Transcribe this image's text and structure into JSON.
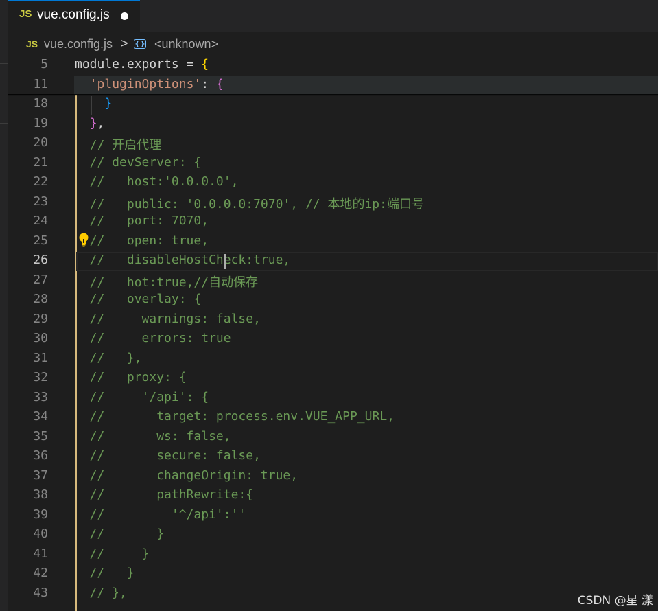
{
  "tab": {
    "badge": "JS",
    "filename": "vue.config.js"
  },
  "breadcrumb": {
    "badge": "JS",
    "file": "vue.config.js",
    "separator": ">",
    "symbol": "<unknown>"
  },
  "lines": [
    {
      "n": "5",
      "segs": [
        {
          "t": "module.exports = ",
          "c": "white"
        },
        {
          "t": "{",
          "c": "yellow"
        }
      ]
    },
    {
      "n": "11",
      "segs": [
        {
          "t": "  ",
          "c": "white"
        },
        {
          "t": "'pluginOptions'",
          "c": "str"
        },
        {
          "t": ": ",
          "c": "white"
        },
        {
          "t": "{",
          "c": "pink"
        }
      ]
    },
    {
      "n": "18",
      "segs": [
        {
          "t": "    ",
          "c": "white"
        },
        {
          "t": "}",
          "c": "blue"
        }
      ]
    },
    {
      "n": "19",
      "segs": [
        {
          "t": "  ",
          "c": "white"
        },
        {
          "t": "}",
          "c": "pink"
        },
        {
          "t": ",",
          "c": "white"
        }
      ]
    },
    {
      "n": "20",
      "segs": [
        {
          "t": "  // 开启代理",
          "c": "comment"
        }
      ]
    },
    {
      "n": "21",
      "segs": [
        {
          "t": "  // devServer: {",
          "c": "comment"
        }
      ]
    },
    {
      "n": "22",
      "segs": [
        {
          "t": "  //   host:'0.0.0.0',",
          "c": "comment"
        }
      ]
    },
    {
      "n": "23",
      "segs": [
        {
          "t": "  //   public: '0.0.0.0:7070', // 本地的ip:端口号",
          "c": "comment"
        }
      ]
    },
    {
      "n": "24",
      "segs": [
        {
          "t": "  //   port: 7070,",
          "c": "comment"
        }
      ]
    },
    {
      "n": "25",
      "segs": [
        {
          "t": "  //   open: true,",
          "c": "comment"
        }
      ]
    },
    {
      "n": "26",
      "segs": [
        {
          "t": "  //   disableHostCheck:true,",
          "c": "comment"
        }
      ]
    },
    {
      "n": "27",
      "segs": [
        {
          "t": "  //   hot:true,//自动保存",
          "c": "comment"
        }
      ]
    },
    {
      "n": "28",
      "segs": [
        {
          "t": "  //   overlay: {",
          "c": "comment"
        }
      ]
    },
    {
      "n": "29",
      "segs": [
        {
          "t": "  //     warnings: false,",
          "c": "comment"
        }
      ]
    },
    {
      "n": "30",
      "segs": [
        {
          "t": "  //     errors: true",
          "c": "comment"
        }
      ]
    },
    {
      "n": "31",
      "segs": [
        {
          "t": "  //   },",
          "c": "comment"
        }
      ]
    },
    {
      "n": "32",
      "segs": [
        {
          "t": "  //   proxy: {",
          "c": "comment"
        }
      ]
    },
    {
      "n": "33",
      "segs": [
        {
          "t": "  //     '/api': {",
          "c": "comment"
        }
      ]
    },
    {
      "n": "34",
      "segs": [
        {
          "t": "  //       target: process.env.VUE_APP_URL,",
          "c": "comment"
        }
      ]
    },
    {
      "n": "35",
      "segs": [
        {
          "t": "  //       ws: false,",
          "c": "comment"
        }
      ]
    },
    {
      "n": "36",
      "segs": [
        {
          "t": "  //       secure: false,",
          "c": "comment"
        }
      ]
    },
    {
      "n": "37",
      "segs": [
        {
          "t": "  //       changeOrigin: true,",
          "c": "comment"
        }
      ]
    },
    {
      "n": "38",
      "segs": [
        {
          "t": "  //       pathRewrite:{",
          "c": "comment"
        }
      ]
    },
    {
      "n": "39",
      "segs": [
        {
          "t": "  //         '^/api':''",
          "c": "comment"
        }
      ]
    },
    {
      "n": "40",
      "segs": [
        {
          "t": "  //       }",
          "c": "comment"
        }
      ]
    },
    {
      "n": "41",
      "segs": [
        {
          "t": "  //     }",
          "c": "comment"
        }
      ]
    },
    {
      "n": "42",
      "segs": [
        {
          "t": "  //   }",
          "c": "comment"
        }
      ]
    },
    {
      "n": "43",
      "segs": [
        {
          "t": "  // },",
          "c": "comment"
        }
      ]
    }
  ],
  "active_line": "26",
  "watermark": "CSDN @星  漾",
  "colors": {
    "editor_bg": "#1e1e1e",
    "string": "#ce9178",
    "comment": "#6a9955",
    "bracket_yellow": "#ffd700",
    "bracket_pink": "#da70d6",
    "bracket_blue": "#179fff",
    "git_modified": "#d7ba7d"
  },
  "icons": {
    "lightbulb": "lightbulb-icon",
    "symbol": "symbol-namespace-icon",
    "dirty": "unsaved-dot-icon"
  }
}
